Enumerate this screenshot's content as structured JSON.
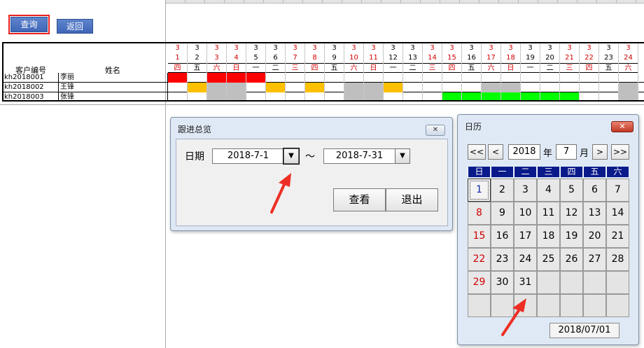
{
  "toolbar": {
    "query_label": "查询",
    "back_label": "返回"
  },
  "table": {
    "col_customer_id": "客户编号",
    "col_name": "姓名",
    "day_numbers": [
      "1",
      "2",
      "3",
      "4",
      "5",
      "6",
      "7",
      "8",
      "9",
      "10",
      "11",
      "12",
      "13",
      "14",
      "15",
      "16",
      "17",
      "18",
      "19",
      "20",
      "21",
      "22",
      "23",
      "24"
    ],
    "weekdays": [
      "四",
      "五",
      "六",
      "日",
      "一",
      "二",
      "三",
      "四",
      "五",
      "六",
      "日",
      "一",
      "二",
      "三",
      "四",
      "五",
      "六",
      "日",
      "一",
      "二",
      "三",
      "四",
      "五",
      "六"
    ],
    "month_marks": [
      "3",
      "3",
      "3",
      "3",
      "3",
      "3",
      "3",
      "3",
      "3",
      "3",
      "3",
      "3",
      "3",
      "3",
      "3",
      "3",
      "3",
      "3",
      "3",
      "3",
      "3",
      "3",
      "3",
      "3"
    ],
    "red_days": [
      1,
      3,
      4,
      7,
      8,
      10,
      11,
      14,
      15,
      17,
      18,
      21,
      22,
      24
    ],
    "rows": [
      {
        "id": "kh2018001",
        "name": "李丽"
      },
      {
        "id": "kh2018002",
        "name": "王锋"
      },
      {
        "id": "kh2018003",
        "name": "张锋"
      }
    ],
    "colors": {
      "red": "#ff0000",
      "orange": "#ffc000",
      "gray": "#bfbfbf",
      "green": "#00ff00"
    }
  },
  "dialog_summary": {
    "title": "跟进总览",
    "date_label": "日期",
    "start_date": "2018-7-1",
    "tilde": "～",
    "end_date": "2018-7-31",
    "view_label": "查看",
    "exit_label": "退出"
  },
  "calendar": {
    "title": "日历",
    "prev_year": "<<",
    "prev_month": "<",
    "year": "2018",
    "year_unit": "年",
    "month": "7",
    "month_unit": "月",
    "next_month": ">",
    "next_year": ">>",
    "weekdays": [
      "日",
      "一",
      "二",
      "三",
      "四",
      "五",
      "六"
    ],
    "days": [
      "1",
      "2",
      "3",
      "4",
      "5",
      "6",
      "7",
      "8",
      "9",
      "10",
      "11",
      "12",
      "13",
      "14",
      "15",
      "16",
      "17",
      "18",
      "19",
      "20",
      "21",
      "22",
      "23",
      "24",
      "25",
      "26",
      "27",
      "28",
      "29",
      "30",
      "31"
    ],
    "selected_date": "2018/07/01"
  }
}
